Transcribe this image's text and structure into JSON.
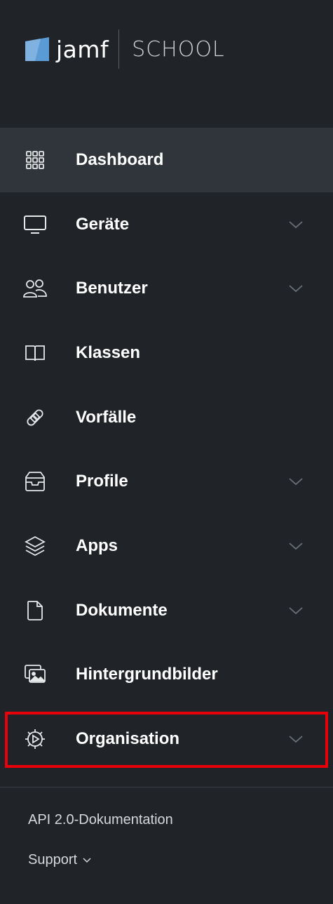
{
  "brand": {
    "word": "jamf",
    "product": "SCHOOL",
    "accent": "#5b9bd5"
  },
  "nav": {
    "items": [
      {
        "label": "Dashboard",
        "icon": "grid-icon",
        "active": true,
        "expandable": false
      },
      {
        "label": "Geräte",
        "icon": "monitor-icon",
        "active": false,
        "expandable": true
      },
      {
        "label": "Benutzer",
        "icon": "users-icon",
        "active": false,
        "expandable": true
      },
      {
        "label": "Klassen",
        "icon": "book-icon",
        "active": false,
        "expandable": false
      },
      {
        "label": "Vorfälle",
        "icon": "bandage-icon",
        "active": false,
        "expandable": false
      },
      {
        "label": "Profile",
        "icon": "inbox-icon",
        "active": false,
        "expandable": true
      },
      {
        "label": "Apps",
        "icon": "layers-icon",
        "active": false,
        "expandable": true
      },
      {
        "label": "Dokumente",
        "icon": "file-icon",
        "active": false,
        "expandable": true
      },
      {
        "label": "Hintergrundbilder",
        "icon": "images-icon",
        "active": false,
        "expandable": false
      },
      {
        "label": "Organisation",
        "icon": "gear-icon",
        "active": false,
        "expandable": true,
        "highlighted": true
      }
    ]
  },
  "footer": {
    "api_label": "API 2.0-Dokumentation",
    "support_label": "Support"
  },
  "colors": {
    "sidebar_bg": "#202327",
    "active_bg": "#30353b",
    "highlight_border": "#e8000b",
    "icon_stroke": "#e6e8ea",
    "chevron": "#6b7078"
  }
}
